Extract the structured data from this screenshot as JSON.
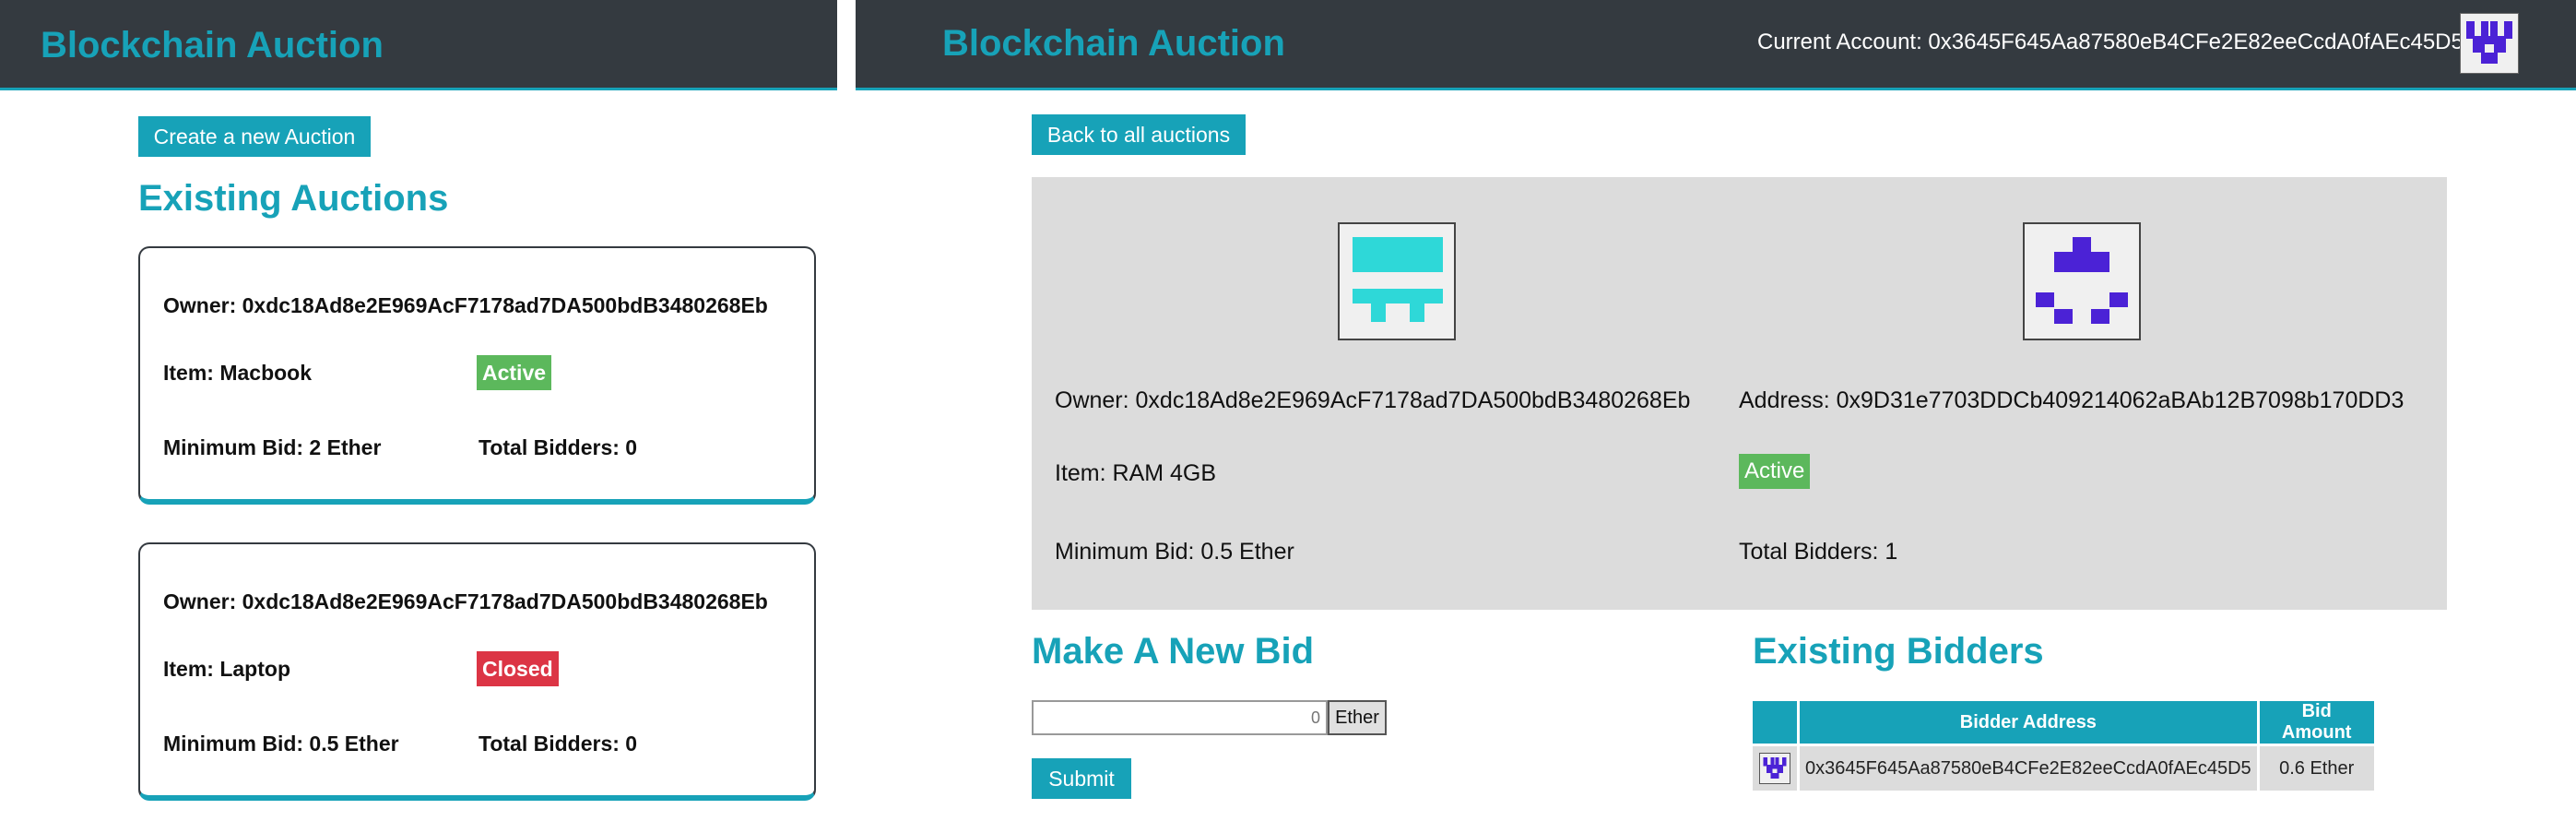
{
  "left": {
    "brand": "Blockchain Auction",
    "create_button": "Create a new Auction",
    "section_title": "Existing Auctions",
    "auctions": [
      {
        "owner": "Owner: 0xdc18Ad8e2E969AcF7178ad7DA500bdB3480268Eb",
        "item": "Item: Macbook",
        "status": "Active",
        "min_bid": "Minimum Bid: 2 Ether",
        "total_bidders": "Total Bidders: 0"
      },
      {
        "owner": "Owner: 0xdc18Ad8e2E969AcF7178ad7DA500bdB3480268Eb",
        "item": "Item: Laptop",
        "status": "Closed",
        "min_bid": "Minimum Bid: 0.5 Ether",
        "total_bidders": "Total Bidders: 0"
      }
    ]
  },
  "right": {
    "brand": "Blockchain Auction",
    "current_account": "Current Account: 0x3645F645Aa87580eB4CFe2E82eeCcdA0fAEc45D5",
    "back_button": "Back to all auctions",
    "details": {
      "owner": "Owner: 0xdc18Ad8e2E969AcF7178ad7DA500bdB3480268Eb",
      "item": "Item: RAM 4GB",
      "min_bid": "Minimum Bid: 0.5 Ether",
      "address": "Address: 0x9D31e7703DDCb409214062aBAb12B7098b170DD3",
      "status": "Active",
      "total_bidders": "Total Bidders: 1"
    },
    "new_bid": {
      "title": "Make A New Bid",
      "placeholder": "0",
      "unit": "Ether",
      "submit": "Submit"
    },
    "bidders": {
      "title": "Existing Bidders",
      "col_address": "Bidder Address",
      "col_amount": "Bid Amount",
      "rows": [
        {
          "address": "0x3645F645Aa87580eB4CFe2E82eeCcdA0fAEc45D5",
          "amount": "0.6 Ether"
        }
      ]
    }
  },
  "colors": {
    "navbar": "#343a40",
    "accent": "#17a2b8",
    "active": "#5cb85c",
    "closed": "#dc3545",
    "details_bg": "#dcdcdc",
    "identicon_account": "#4b22d6",
    "identicon_owner": "#2ed8d8"
  }
}
